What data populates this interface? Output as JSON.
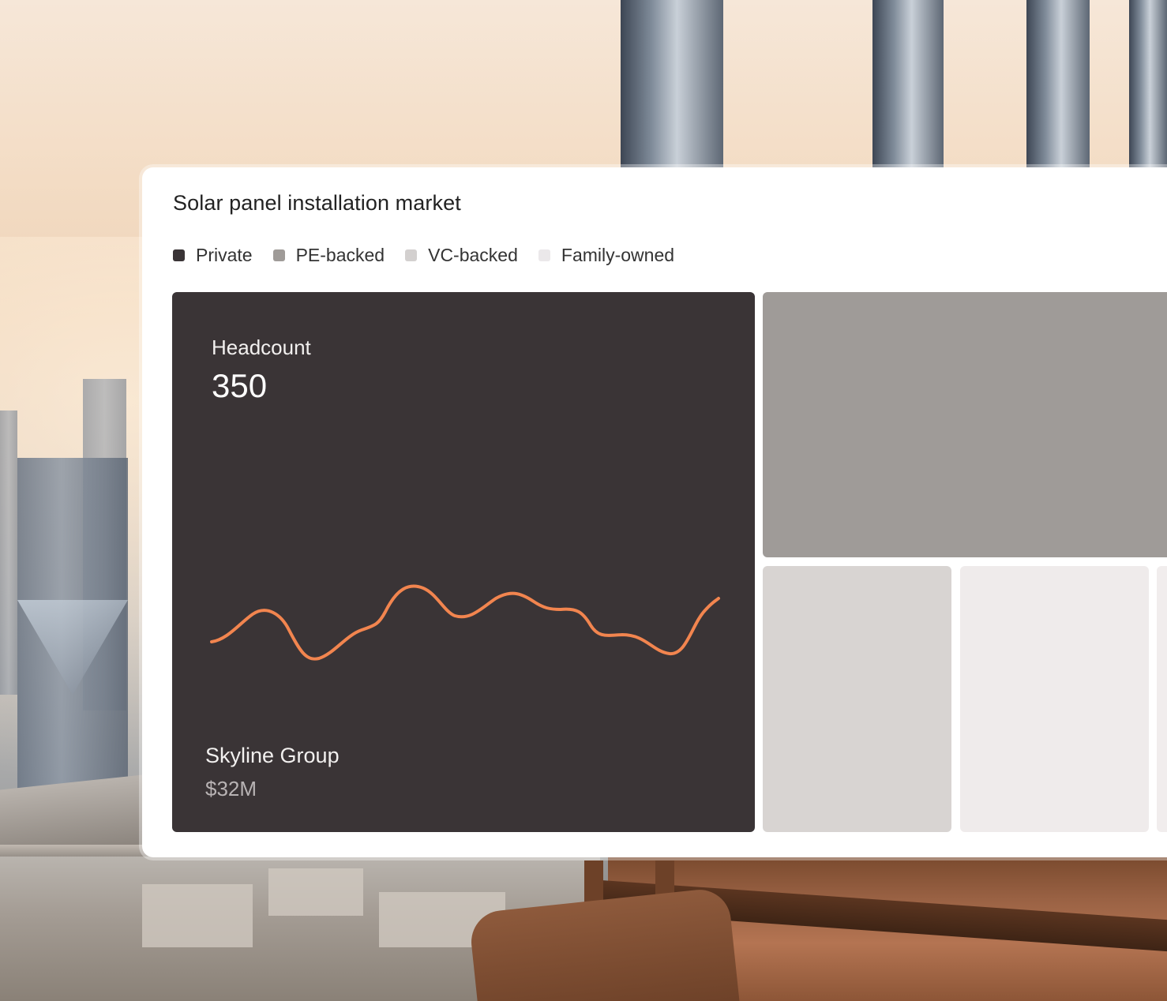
{
  "card": {
    "title": "Solar panel installation market",
    "legend": [
      {
        "label": "Private",
        "color": "#3a3436"
      },
      {
        "label": "PE-backed",
        "color": "#9f9b98"
      },
      {
        "label": "VC-backed",
        "color": "#d3d0cf"
      },
      {
        "label": "Family-owned",
        "color": "#ebe8ea"
      }
    ],
    "featured_tile": {
      "metric_label": "Headcount",
      "metric_value": "350",
      "company": "Skyline Group",
      "amount": "$32M",
      "category": "Private"
    }
  },
  "colors": {
    "sparkline": "#f2854f",
    "card_background": "#ffffff",
    "private": "#3a3436",
    "pe_backed": "#9f9b98",
    "vc_backed": "#d8d4d2",
    "family_owned": "#efebeb"
  },
  "icons": [
    "legend-swatch"
  ]
}
